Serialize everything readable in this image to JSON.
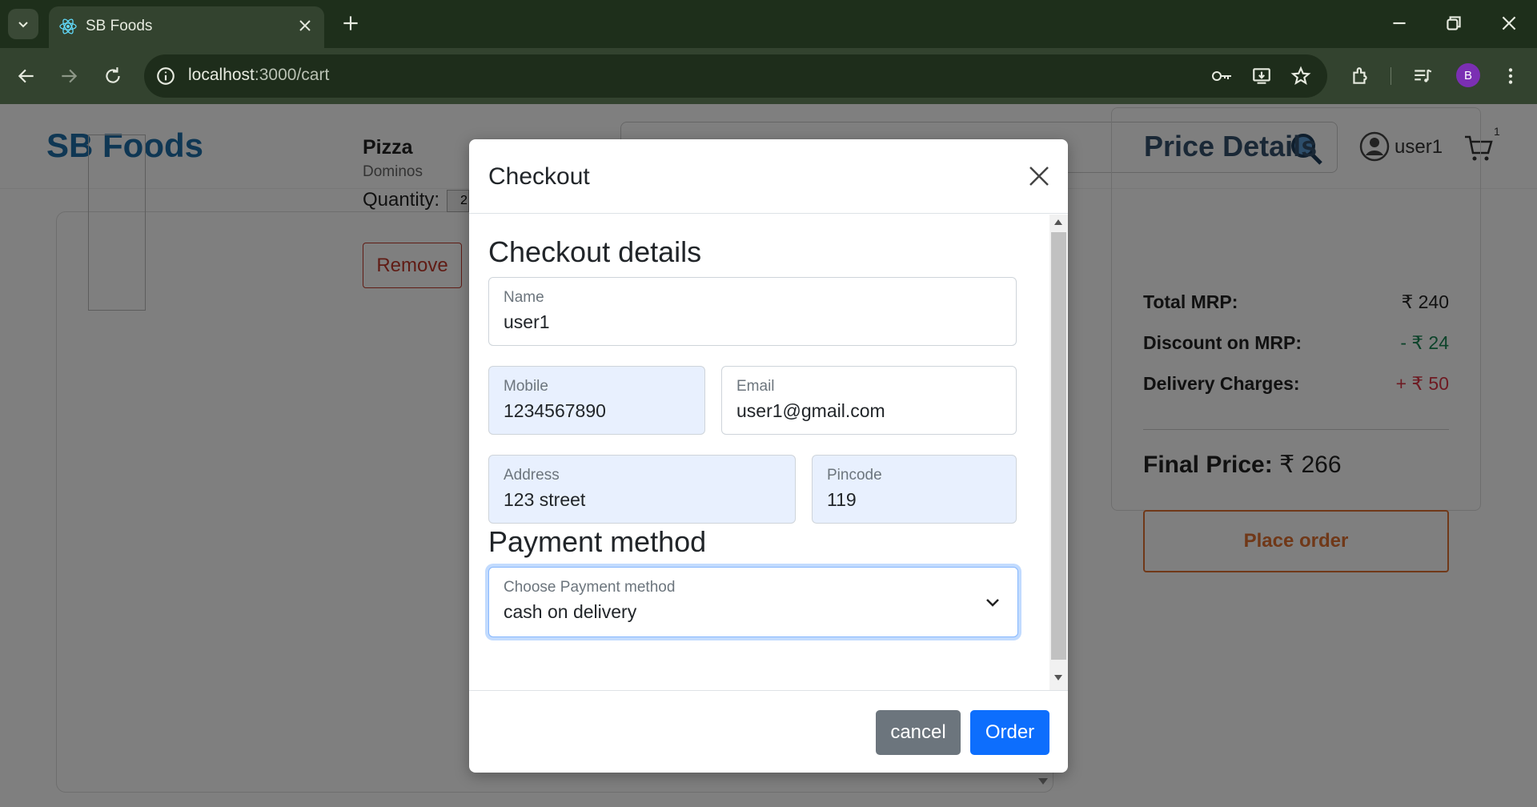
{
  "browser": {
    "tab_title": "SB Foods",
    "url_host": "localhost",
    "url_path": ":3000/cart",
    "profile_initial": "B"
  },
  "header": {
    "brand": "SB Foods",
    "username": "user1",
    "cart_count": "1"
  },
  "cart": {
    "item_name": "Pizza",
    "restaurant": "Dominos",
    "quantity_label": "Quantity:",
    "quantity": "2",
    "remove_label": "Remove"
  },
  "price_details": {
    "title": "Price Details",
    "rows": [
      {
        "label": "Total MRP:",
        "value": "₹ 240",
        "color": "#222222"
      },
      {
        "label": "Discount on MRP:",
        "value": "- ₹ 24",
        "color": "#198754"
      },
      {
        "label": "Delivery Charges:",
        "value": "+ ₹ 50",
        "color": "#dc3545"
      }
    ],
    "final_label": "Final Price:",
    "final_value": "₹ 266",
    "place_order_label": "Place order"
  },
  "modal": {
    "title": "Checkout",
    "details_heading": "Checkout details",
    "name": {
      "label": "Name",
      "value": "user1"
    },
    "mobile": {
      "label": "Mobile",
      "value": "1234567890"
    },
    "email": {
      "label": "Email",
      "value": "user1@gmail.com"
    },
    "address": {
      "label": "Address",
      "value": "123 street"
    },
    "pincode": {
      "label": "Pincode",
      "value": "119"
    },
    "payment_heading": "Payment method",
    "payment": {
      "label": "Choose Payment method",
      "value": "cash on delivery"
    },
    "cancel_label": "cancel",
    "order_label": "Order"
  },
  "colors": {
    "brand": "#1f6fa8",
    "primary": "#0d6efd",
    "secondary": "#6c757d",
    "accent_orange": "#e07030"
  }
}
